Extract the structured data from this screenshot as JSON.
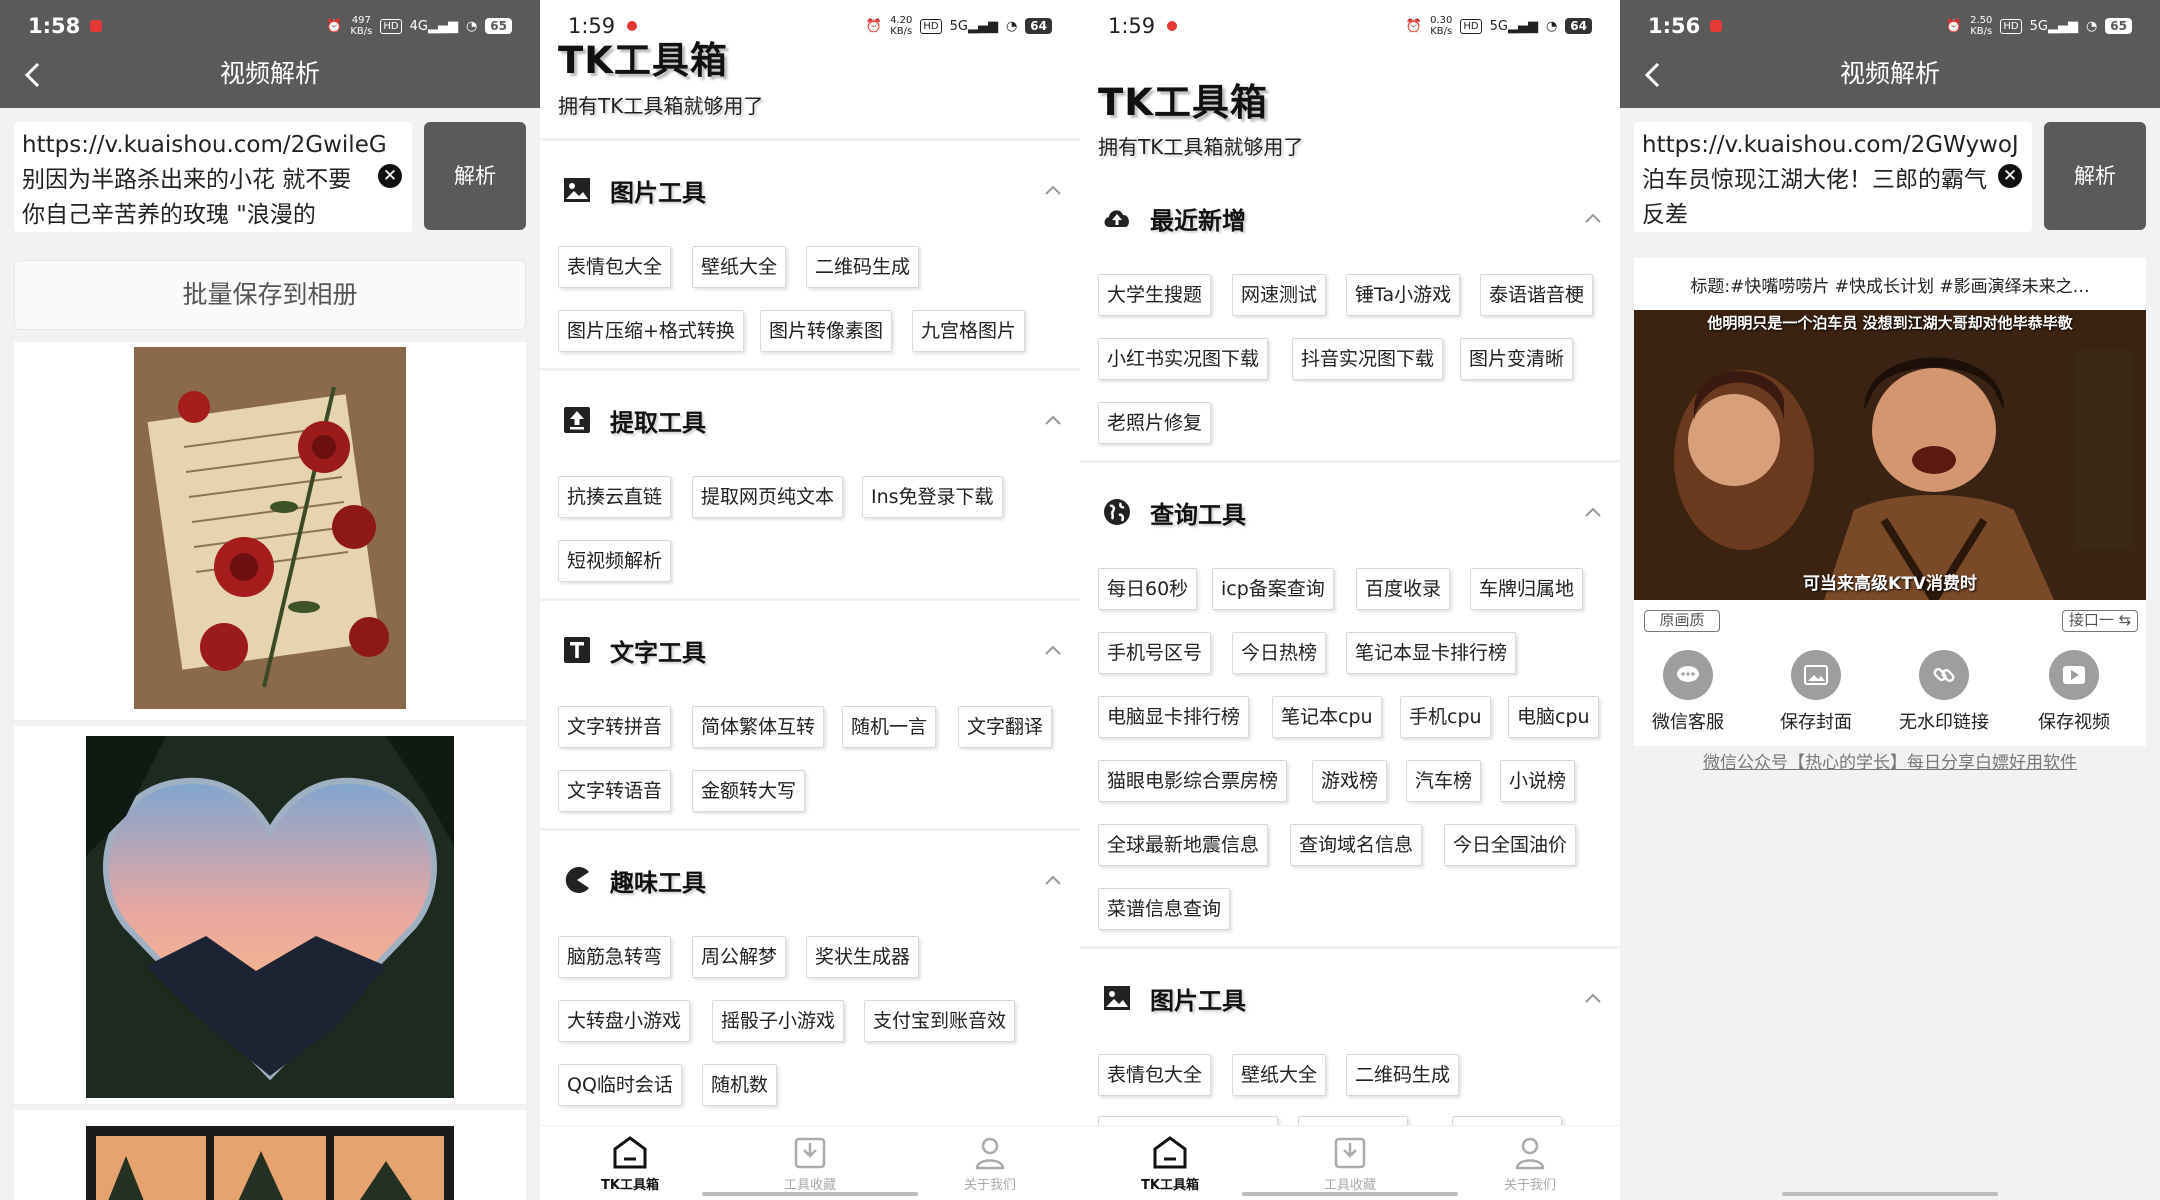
{
  "panel1": {
    "status": {
      "time": "1:58",
      "net_speed": "497",
      "net_unit": "KB/s",
      "hd": "HD",
      "signal": "4G",
      "battery": "65"
    },
    "title": "视频解析",
    "url_text": "https://v.kuaishou.com/2GwileG 别因为半路杀出来的小花 就不要你自己辛苦养的玫瑰 \"浪漫的",
    "parse_label": "解析",
    "batch_label": "批量保存到相册"
  },
  "panel2": {
    "status": {
      "time": "1:59",
      "net_speed": "4.20",
      "net_unit": "KB/s",
      "hd": "HD",
      "signal": "5G",
      "battery": "64"
    },
    "brand": "TK工具箱",
    "slogan": "拥有TK工具箱就够用了",
    "sections": [
      {
        "title": "图片工具",
        "icon": "image-icon",
        "tools": [
          "表情包大全",
          "壁纸大全",
          "二维码生成",
          "图片压缩+格式转换",
          "图片转像素图",
          "九宫格图片"
        ]
      },
      {
        "title": "提取工具",
        "icon": "upload-icon",
        "tools": [
          "抗揍云直链",
          "提取网页纯文本",
          "Ins免登录下载",
          "短视频解析"
        ]
      },
      {
        "title": "文字工具",
        "icon": "text-icon",
        "tools": [
          "文字转拼音",
          "简体繁体互转",
          "随机一言",
          "文字翻译",
          "文字转语音",
          "金额转大写"
        ]
      },
      {
        "title": "趣味工具",
        "icon": "pacman-icon",
        "tools": [
          "脑筋急转弯",
          "周公解梦",
          "奖状生成器",
          "大转盘小游戏",
          "摇骰子小游戏",
          "支付宝到账音效",
          "QQ临时会话",
          "随机数"
        ]
      }
    ],
    "tabs": [
      "TK工具箱",
      "工具收藏",
      "关于我们"
    ]
  },
  "panel3": {
    "status": {
      "time": "1:59",
      "net_speed": "0.30",
      "net_unit": "KB/s",
      "hd": "HD",
      "signal": "5G",
      "battery": "64"
    },
    "brand": "TK工具箱",
    "slogan": "拥有TK工具箱就够用了",
    "sections": [
      {
        "title": "最近新增",
        "icon": "cloud-upload-icon",
        "tools": [
          "大学生搜题",
          "网速测试",
          "锤Ta小游戏",
          "泰语谐音梗",
          "小红书实况图下载",
          "抖音实况图下载",
          "图片变清晰",
          "老照片修复"
        ]
      },
      {
        "title": "查询工具",
        "icon": "globe-icon",
        "tools": [
          "每日60秒",
          "icp备案查询",
          "百度收录",
          "车牌归属地",
          "手机号区号",
          "今日热榜",
          "笔记本显卡排行榜",
          "电脑显卡排行榜",
          "笔记本cpu",
          "手机cpu",
          "电脑cpu",
          "猫眼电影综合票房榜",
          "游戏榜",
          "汽车榜",
          "小说榜",
          "全球最新地震信息",
          "查询域名信息",
          "今日全国油价",
          "菜谱信息查询"
        ]
      },
      {
        "title": "图片工具",
        "icon": "image-icon",
        "tools": [
          "表情包大全",
          "壁纸大全",
          "二维码生成"
        ]
      }
    ],
    "tabs": [
      "TK工具箱",
      "工具收藏",
      "关于我们"
    ]
  },
  "panel4": {
    "status": {
      "time": "1:56",
      "net_speed": "2.50",
      "net_unit": "KB/s",
      "hd": "HD",
      "signal": "5G",
      "battery": "65"
    },
    "title": "视频解析",
    "url_text": "https://v.kuaishou.com/2GWywoJ 泊车员惊现江湖大佬！三郎的霸气反差",
    "parse_label": "解析",
    "video_title": "标题:#快嘴唠唠片 #快成长计划 #影画演绎未来之…",
    "caption_top": "他明明只是一个泊车员 没想到江湖大哥却对他毕恭毕敬",
    "caption_bottom": "可当来高级KTV消费时",
    "quality_left": "原画质",
    "quality_right": "接口一 ⇆",
    "actions": [
      "微信客服",
      "保存封面",
      "无水印链接",
      "保存视频"
    ],
    "wechat_note": "微信公众号【热心的学长】每日分享白嫖好用软件"
  },
  "colors": {
    "topbar": "#5a5a5a",
    "background": "#f2f2f2",
    "chip_border": "#d8d8d8",
    "action_circle": "#9e9e9e"
  }
}
